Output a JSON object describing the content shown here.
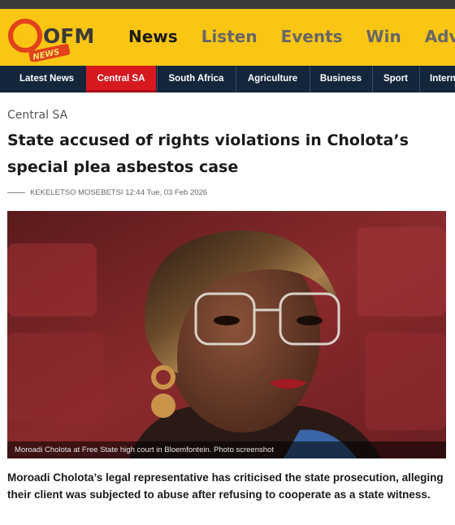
{
  "brand": {
    "name": "OFM",
    "tagline": "NEWS",
    "colors": {
      "masthead": "#fbc514",
      "nav": "#14263c",
      "accent": "#d5191f"
    }
  },
  "main_nav": {
    "items": [
      "News",
      "Listen",
      "Events",
      "Win",
      "Adver"
    ],
    "active": "News"
  },
  "section_nav": {
    "items": [
      "Latest News",
      "Central SA",
      "South Africa",
      "Agriculture",
      "Business",
      "Sport",
      "Intern"
    ],
    "active": "Central SA"
  },
  "article": {
    "category": "Central SA",
    "headline": "State accused of rights violations in Cholota’s special plea asbestos case",
    "author": "KEKELETSO MOSEBETSI",
    "timestamp": "12:44 Tue, 03 Feb 2026",
    "image_caption": "Moroadi Cholota at Free State high court in Bloemfontein. Photo screenshot",
    "summary": "Moroadi Cholota’s legal representative has criticised the state prosecution, alleging their client was subjected to abuse after refusing to cooperate as a state witness."
  }
}
